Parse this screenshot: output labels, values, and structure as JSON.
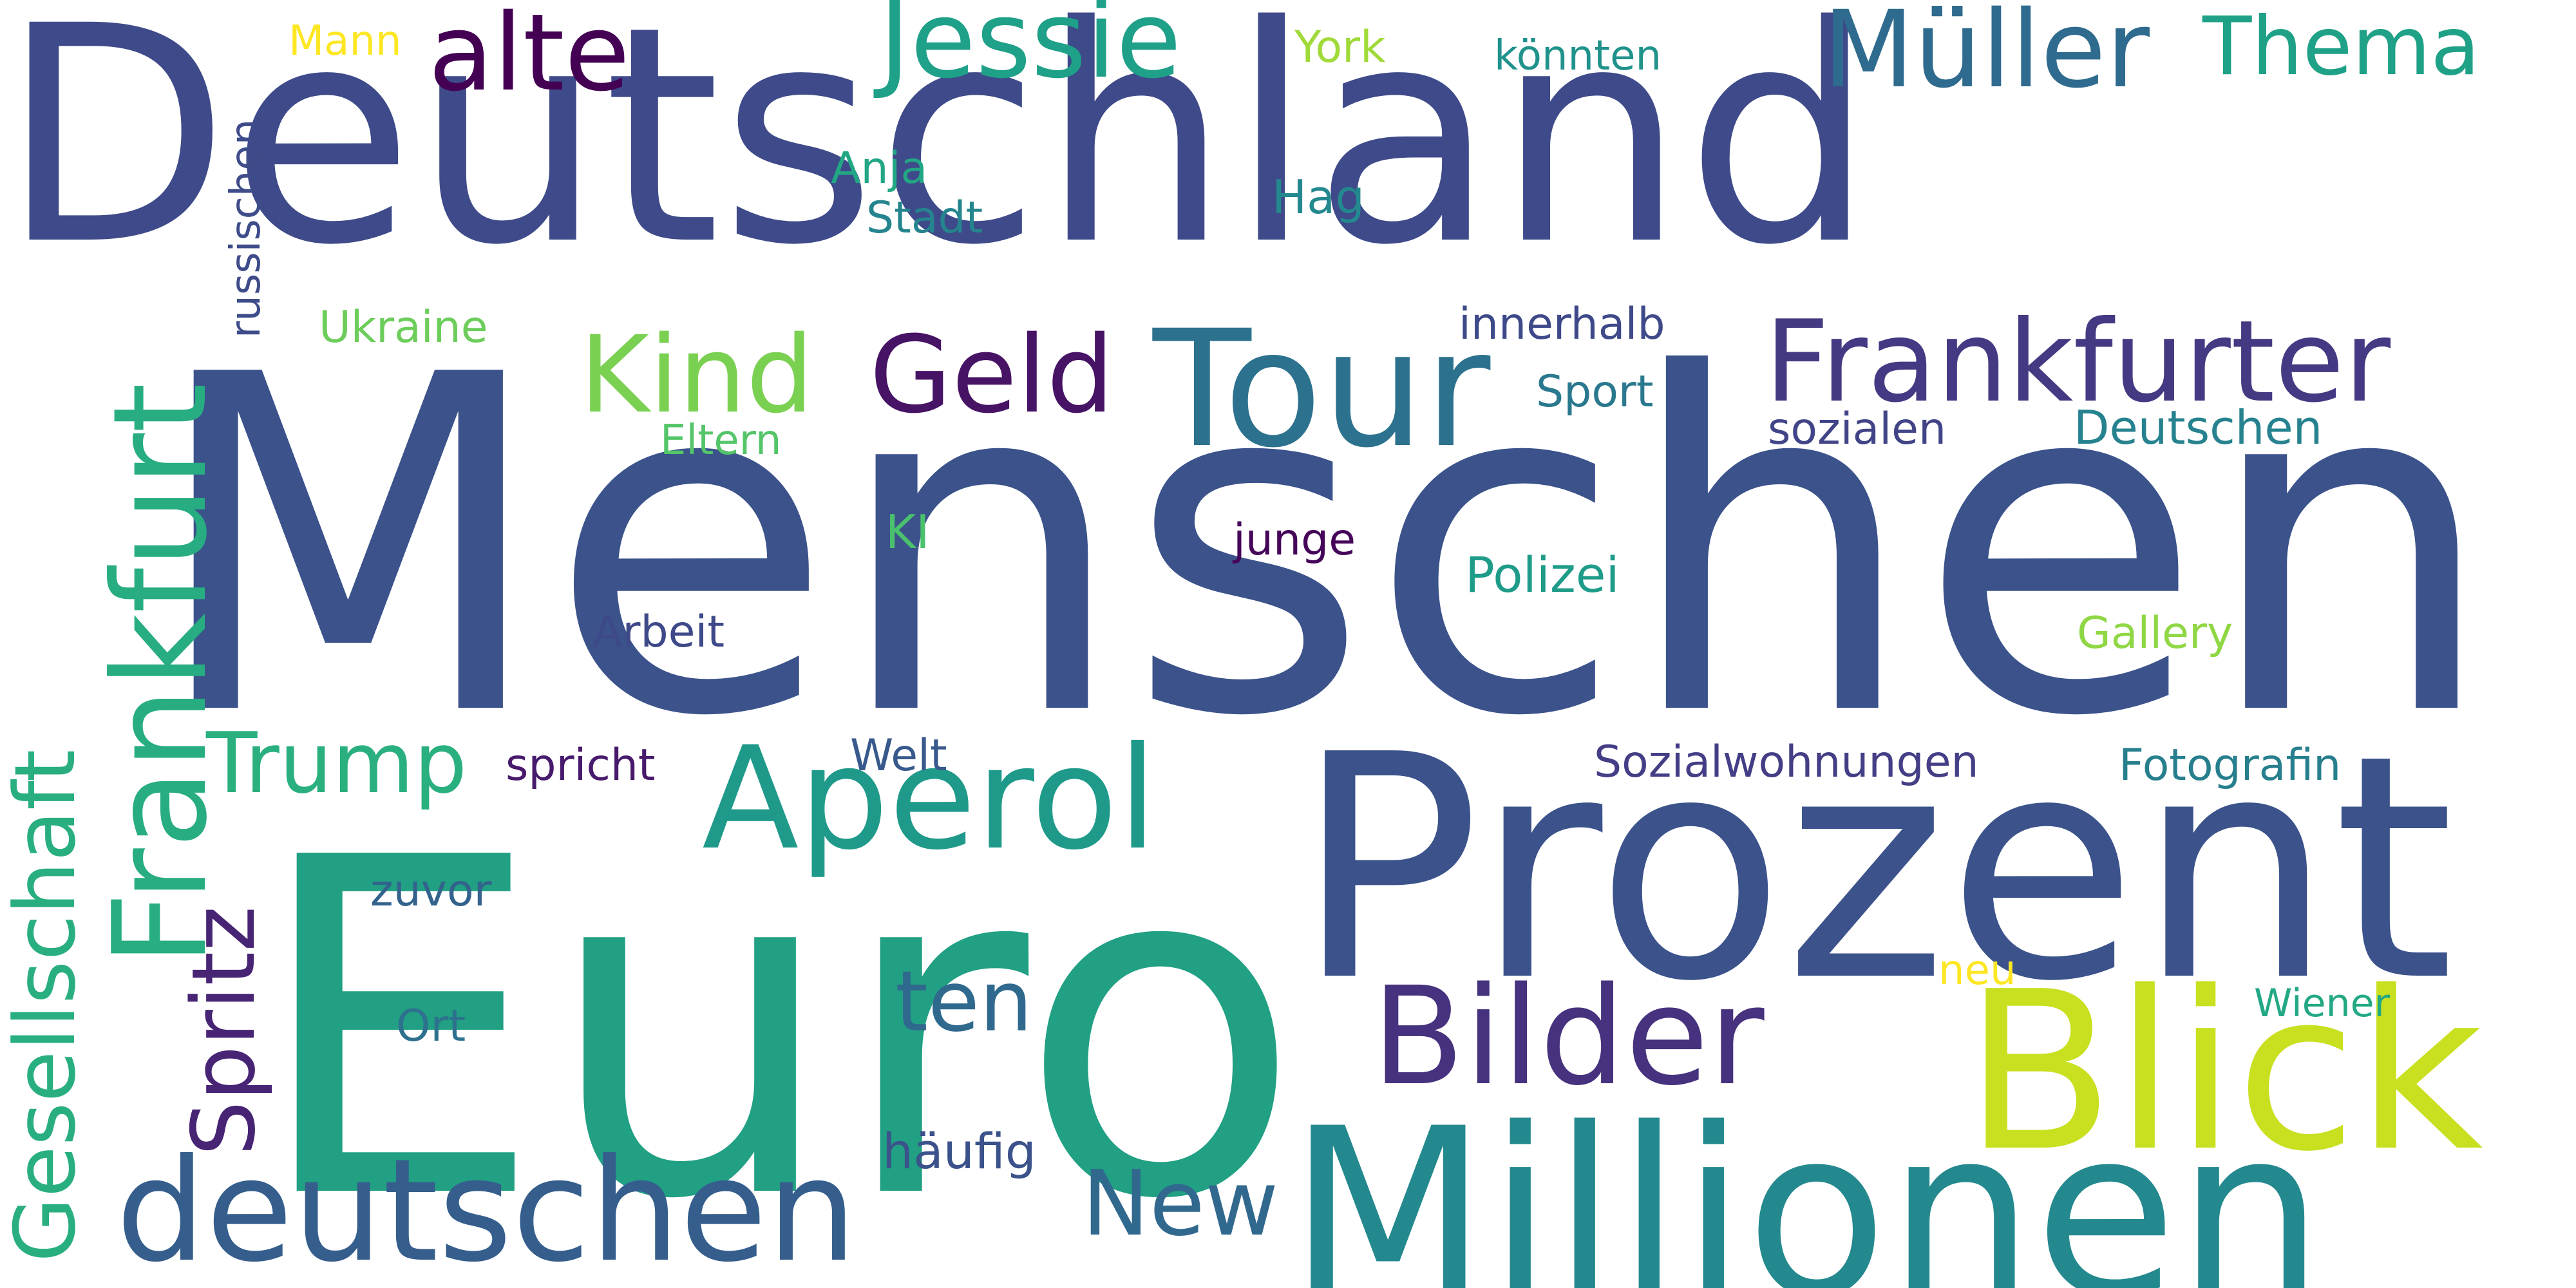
{
  "words": [
    {
      "text": "Deutschland",
      "color": "#3e4a89"
    },
    {
      "text": "Menschen",
      "color": "#3b528b"
    },
    {
      "text": "Euro",
      "color": "#21a083"
    },
    {
      "text": "Prozent",
      "color": "#3b528b"
    },
    {
      "text": "Millionen",
      "color": "#23898e"
    },
    {
      "text": "Blick",
      "color": "#c8e020"
    },
    {
      "text": "Bilder",
      "color": "#46327e"
    },
    {
      "text": "Tour",
      "color": "#2c728e"
    },
    {
      "text": "Frankfurter",
      "color": "#443a83"
    },
    {
      "text": "deutschen",
      "color": "#355e8d"
    },
    {
      "text": "Aperol",
      "color": "#1f9a8a"
    },
    {
      "text": "Müller",
      "color": "#2f6b8e"
    },
    {
      "text": "Jessie",
      "color": "#1fa088"
    },
    {
      "text": "alte",
      "color": "#440154"
    },
    {
      "text": "Geld",
      "color": "#471365"
    },
    {
      "text": "Kind",
      "color": "#7ad151"
    },
    {
      "text": "Thema",
      "color": "#1fa187"
    },
    {
      "text": "Frankfurt",
      "color": "#27ad81"
    },
    {
      "text": "Trump",
      "color": "#2ab07f"
    },
    {
      "text": "New",
      "color": "#31688e"
    },
    {
      "text": "ten",
      "color": "#30698e"
    },
    {
      "text": "Gesellschaft",
      "color": "#29af7f"
    },
    {
      "text": "Spritz",
      "color": "#482475"
    },
    {
      "text": "russischen",
      "color": "#3e4c8a"
    },
    {
      "text": "Mann",
      "color": "#fde725"
    },
    {
      "text": "York",
      "color": "#a0da39"
    },
    {
      "text": "könnten",
      "color": "#20928c"
    },
    {
      "text": "Anja",
      "color": "#22a785"
    },
    {
      "text": "Stadt",
      "color": "#25858e"
    },
    {
      "text": "Hag",
      "color": "#23898e"
    },
    {
      "text": "Ukraine",
      "color": "#6ccd5a"
    },
    {
      "text": "innerhalb",
      "color": "#3e4989"
    },
    {
      "text": "Sport",
      "color": "#2a788e"
    },
    {
      "text": "Eltern",
      "color": "#54c568"
    },
    {
      "text": "sozialen",
      "color": "#414487"
    },
    {
      "text": "Deutschen",
      "color": "#26828e"
    },
    {
      "text": "KI",
      "color": "#4ac16d"
    },
    {
      "text": "junge",
      "color": "#450559"
    },
    {
      "text": "Polizei",
      "color": "#1e9c89"
    },
    {
      "text": "Arbeit",
      "color": "#3e4989"
    },
    {
      "text": "Gallery",
      "color": "#8fd744"
    },
    {
      "text": "Welt",
      "color": "#38598c"
    },
    {
      "text": "spricht",
      "color": "#481a6c"
    },
    {
      "text": "Sozialwohnungen",
      "color": "#433e85"
    },
    {
      "text": "Fotografin",
      "color": "#277f8e"
    },
    {
      "text": "zuvor",
      "color": "#33638d"
    },
    {
      "text": "neu",
      "color": "#fde725"
    },
    {
      "text": "Wiener",
      "color": "#22a884"
    },
    {
      "text": "Ort",
      "color": "#2d718e"
    },
    {
      "text": "häufig",
      "color": "#3b528b"
    }
  ]
}
